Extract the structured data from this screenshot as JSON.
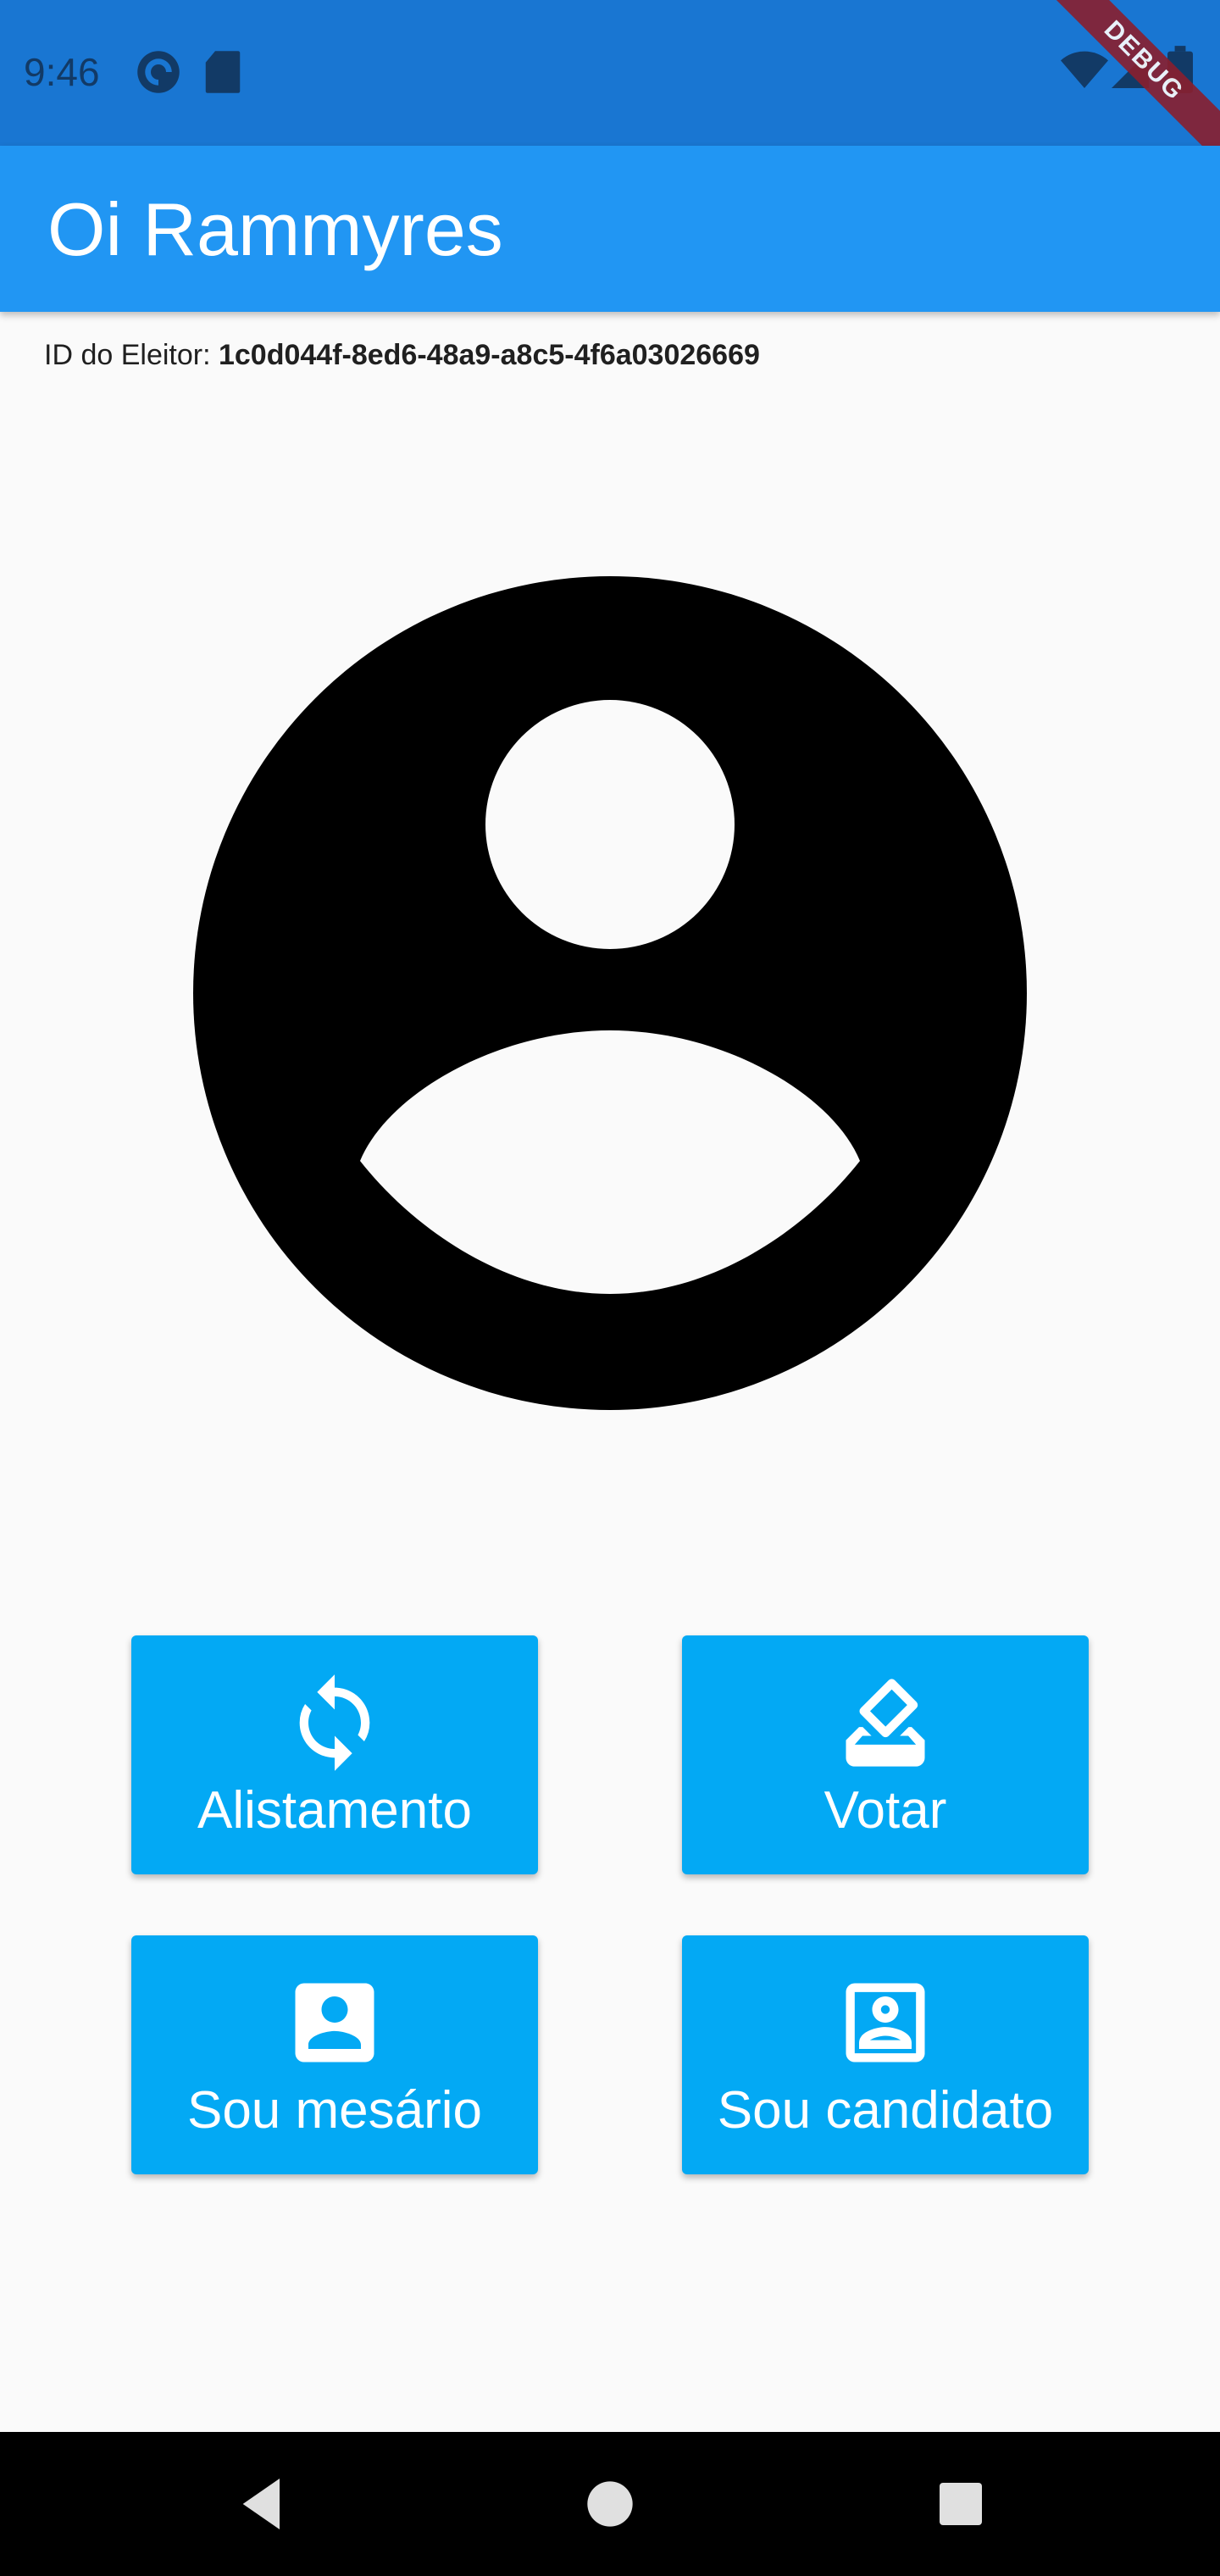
{
  "status_bar": {
    "time": "9:46",
    "debug_banner": "DEBUG",
    "icons": [
      "pocket-casts-icon",
      "sd-card-icon",
      "wifi-icon",
      "signal-icon",
      "battery-icon"
    ]
  },
  "app_bar": {
    "title": "Oi Rammyres"
  },
  "voter": {
    "id_label": "ID do Eleitor:",
    "id_value": "1c0d044f-8ed6-48a9-a8c5-4f6a03026669"
  },
  "avatar": {
    "icon": "account-circle-icon"
  },
  "actions": [
    {
      "label": "Alistamento",
      "icon": "sync-icon"
    },
    {
      "label": "Votar",
      "icon": "ballot-box-icon"
    },
    {
      "label": "Sou mesário",
      "icon": "contact-card-icon"
    },
    {
      "label": "Sou candidato",
      "icon": "portrait-frame-icon"
    }
  ],
  "nav_bar": {
    "buttons": [
      "back-icon",
      "home-icon",
      "recents-icon"
    ]
  },
  "colors": {
    "status_bar": "#1976d2",
    "app_bar": "#2196f3",
    "button": "#03a9f4",
    "background": "#fafafa"
  }
}
